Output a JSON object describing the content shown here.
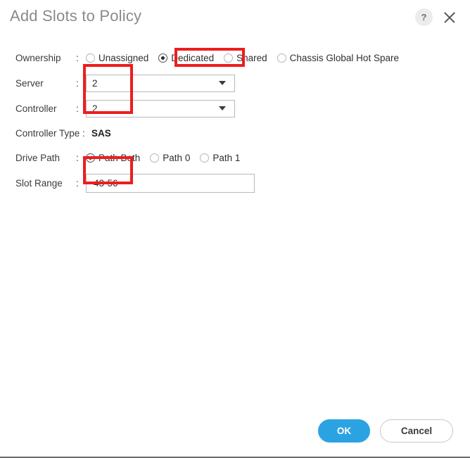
{
  "dialog": {
    "title": "Add Slots to Policy",
    "help_icon": "?",
    "help_icon_name": "help-icon",
    "close_icon_name": "close-icon"
  },
  "colors": {
    "primary_button": "#2ba3e3",
    "annotation_box": "#ee1d1d",
    "title_text": "#8a8a8a",
    "label_text": "#3b3b3b"
  },
  "form": {
    "colon": ":",
    "ownership": {
      "label": "Ownership",
      "options": [
        {
          "label": "Unassigned",
          "selected": false
        },
        {
          "label": "Dedicated",
          "selected": true
        },
        {
          "label": "Shared",
          "selected": false
        },
        {
          "label": "Chassis Global Hot Spare",
          "selected": false
        }
      ]
    },
    "server": {
      "label": "Server",
      "value": "2"
    },
    "controller": {
      "label": "Controller",
      "value": "2"
    },
    "controller_type": {
      "label": "Controller Type :",
      "value": "SAS"
    },
    "drive_path": {
      "label": "Drive Path",
      "options": [
        {
          "label": "Path Both",
          "selected": true
        },
        {
          "label": "Path 0",
          "selected": false
        },
        {
          "label": "Path 1",
          "selected": false
        }
      ]
    },
    "slot_range": {
      "label": "Slot Range",
      "value": "43-56",
      "placeholder": ""
    }
  },
  "footer": {
    "ok_label": "OK",
    "cancel_label": "Cancel"
  }
}
